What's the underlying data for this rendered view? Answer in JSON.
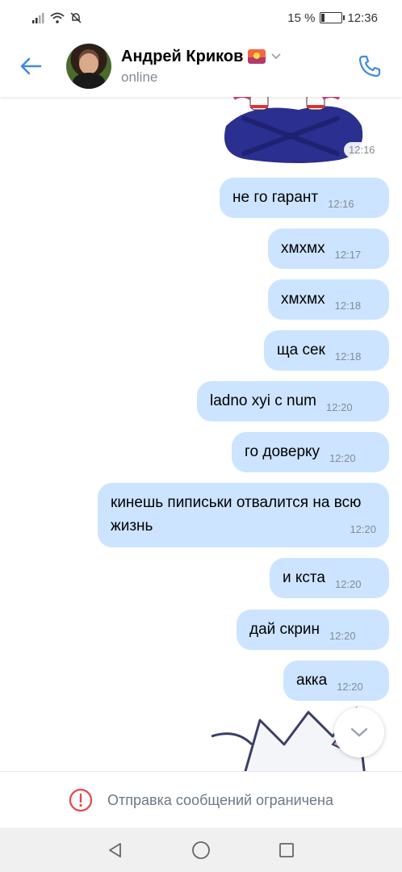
{
  "status_bar": {
    "battery_percent": "15 %",
    "battery_level": 0.15,
    "time": "12:36"
  },
  "header": {
    "name": "Андрей Криков",
    "status": "online",
    "icons": [
      "back-arrow-icon",
      "chevron-down-icon",
      "phone-icon"
    ],
    "accent_color": "#3f8ae0"
  },
  "messages": [
    {
      "text": "не го гарант",
      "time": "12:16"
    },
    {
      "text": "хмхмх",
      "time": "12:17"
    },
    {
      "text": "хмхмх",
      "time": "12:18"
    },
    {
      "text": "ща сек",
      "time": "12:18"
    },
    {
      "text": "ladno xyi c num",
      "time": "12:20"
    },
    {
      "text": "го доверку",
      "time": "12:20"
    },
    {
      "text": "кинешь пиписьки отвалится на всю жизнь",
      "time": "12:20"
    },
    {
      "text": "и кста",
      "time": "12:20"
    },
    {
      "text": "дай скрин",
      "time": "12:20"
    },
    {
      "text": "акка",
      "time": "12:20"
    }
  ],
  "sticker_top": {
    "time": "12:16"
  },
  "composer": {
    "restricted_text": "Отправка сообщений ограничена",
    "icon": "warning-circle-icon",
    "warning_color": "#e64646"
  },
  "bubble_color": "#cce4ff"
}
